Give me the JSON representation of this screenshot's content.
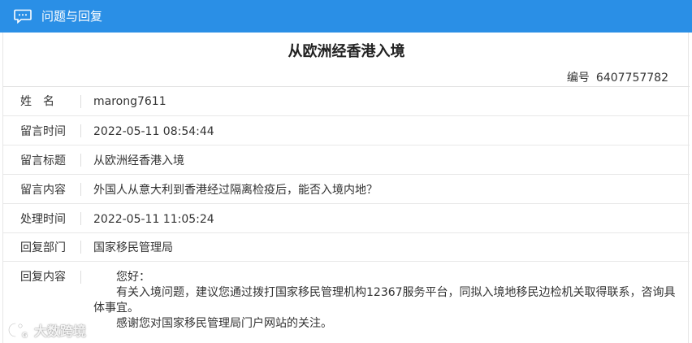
{
  "header": {
    "title": "问题与回复",
    "icon": "chat-bubble-icon",
    "bg_color": "#2a8fe6"
  },
  "main": {
    "title": "从欧洲经香港入境",
    "serial_label": "编号",
    "serial_value": "6407757782"
  },
  "fields": [
    {
      "label": "姓　名",
      "value": "marong7611"
    },
    {
      "label": "留言时间",
      "value": "2022-05-11 08:54:44"
    },
    {
      "label": "留言标题",
      "value": "从欧洲经香港入境"
    },
    {
      "label": "留言内容",
      "value": "外国人从意大利到香港经过隔离检疫后，能否入境内地？"
    },
    {
      "label": "处理时间",
      "value": "2022-05-11 11:05:24"
    },
    {
      "label": "回复部门",
      "value": "国家移民管理局"
    }
  ],
  "reply": {
    "label": "回复内容",
    "paragraphs": [
      "您好：",
      "有关入境问题，建议您通过拨打国家移民管理机构12367服务平台，同拟入境地移民边检机关取得联系，咨询具体事宜。",
      "感谢您对国家移民管理局门户网站的关注。"
    ]
  },
  "watermark": {
    "text": "大数跨境",
    "icon": "logo-icon"
  }
}
